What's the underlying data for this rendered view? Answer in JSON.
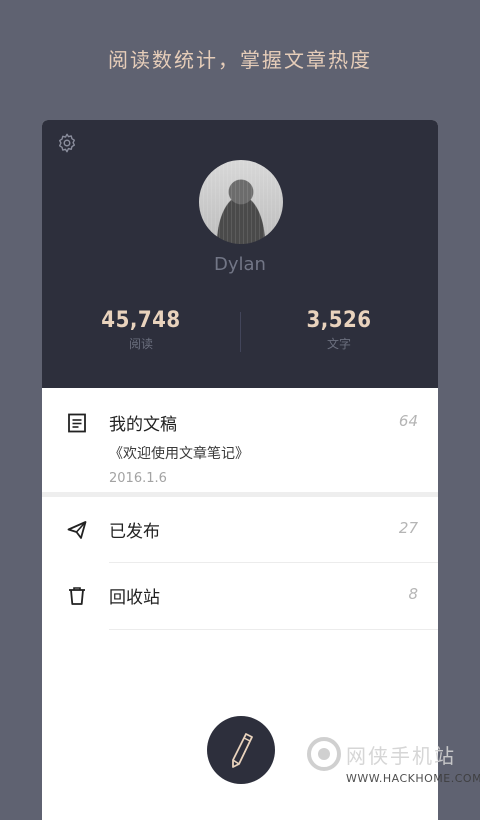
{
  "headline": "阅读数统计，掌握文章热度",
  "profile": {
    "username": "Dylan",
    "stats": [
      {
        "value": "45,748",
        "label": "阅读"
      },
      {
        "value": "3,526",
        "label": "文字"
      }
    ]
  },
  "menu": {
    "drafts": {
      "label": "我的文稿",
      "count": "64",
      "latest_title": "《欢迎使用文章笔记》",
      "latest_date": "2016.1.6"
    },
    "published": {
      "label": "已发布",
      "count": "27"
    },
    "trash": {
      "label": "回收站",
      "count": "8"
    }
  },
  "watermark": {
    "cn": "网侠手机站",
    "en": "WWW.HACKHOME.COM"
  },
  "colors": {
    "background": "#5f6271",
    "header": "#2d2f3c",
    "accent": "#e9d3bd"
  }
}
